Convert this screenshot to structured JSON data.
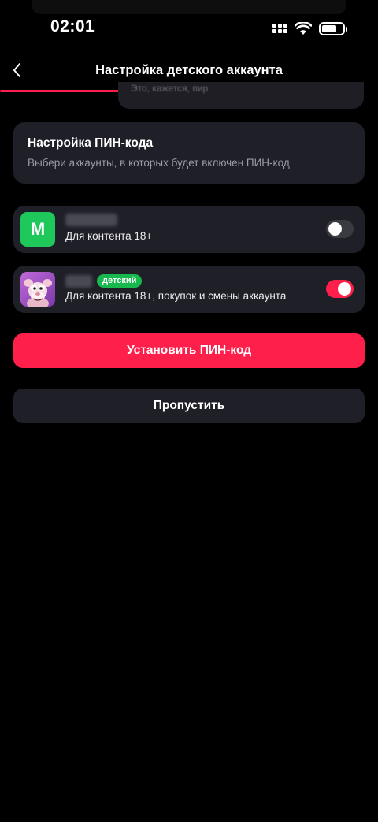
{
  "status_bar": {
    "time": "02:01",
    "icons": [
      "signal-icon",
      "wifi-icon",
      "battery-icon"
    ]
  },
  "header": {
    "title": "Настройка детского аккаунта",
    "back_icon": "chevron-left-icon"
  },
  "peek_card": {
    "text": "Это, кажется, пир"
  },
  "pin_card": {
    "title": "Настройка ПИН-кода",
    "subtitle": "Выбери аккаунты, в которых будет включен ПИН-код"
  },
  "accounts": [
    {
      "avatar_letter": "M",
      "avatar_color": "#1ec85a",
      "description": "Для контента 18+",
      "pin_enabled": false
    },
    {
      "badge": "детский",
      "badge_color": "#17b84e",
      "description": "Для контента 18+, покупок и смены аккаунта",
      "pin_enabled": true
    }
  ],
  "buttons": {
    "primary": "Установить ПИН-код",
    "secondary": "Пропустить"
  },
  "colors": {
    "accent": "#ff1f4b",
    "card": "#1f1f27",
    "background": "#000000"
  }
}
